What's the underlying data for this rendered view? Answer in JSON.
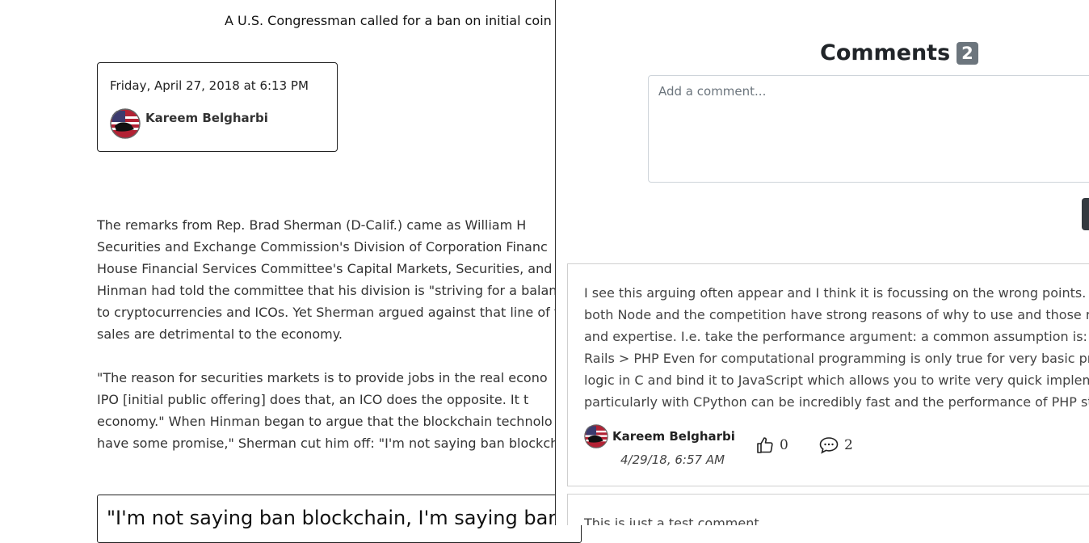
{
  "article": {
    "subtitle": "A U.S. Congressman called for a ban on initial coin",
    "meta": {
      "date": "Friday, April 27, 2018 at 6:13 PM",
      "author": "Kareem Belgharbi"
    },
    "paragraph1": [
      "The remarks from Rep. Brad Sherman (D-Calif.) came as William H",
      "Securities and Exchange Commission's Division of Corporation Financ",
      "House Financial Services Committee's Capital Markets, Securities, and",
      "Hinman had told the committee that his division is \"striving for a balanc",
      "to cryptocurrencies and ICOs. Yet Sherman argued against that line of t",
      "sales are detrimental to the economy."
    ],
    "paragraph2": [
      "\"The reason for securities markets is to provide jobs in the real econo",
      "IPO [initial public offering] does that, an ICO does the opposite. It t",
      "economy.\" When Hinman began to argue that the blockchain technolo",
      "have some promise,\" Sherman cut him off: \"I'm not saying ban blockcha"
    ],
    "quote": "\"I'm not saying ban blockchain, I'm saying ban th"
  },
  "comments_panel": {
    "title": "Comments",
    "count": "2",
    "input_placeholder": "Add a comment...",
    "comments": [
      {
        "lines": [
          "I see this arguing often appear and I think it is focussing on the wrong points. I",
          "both Node and the competition have strong reasons of why to use and those re",
          "and expertise. I.e. take the performance argument: a common assumption is: Go",
          "Rails > PHP Even for computational programming is only true for very basic pro",
          "logic in C and bind it to JavaScript which allows you to write very quick implem",
          "particularly with CPython can be incredibly fast and the performance of PHP str"
        ],
        "author": "Kareem Belgharbi",
        "date": "4/29/18, 6:57 AM",
        "likes": "0",
        "replies": "2"
      },
      {
        "lines": [
          "This is just a test comment"
        ]
      }
    ]
  },
  "colors": {
    "badge": "#6c757d",
    "button": "#343a40",
    "border": "#cfcfcf"
  }
}
